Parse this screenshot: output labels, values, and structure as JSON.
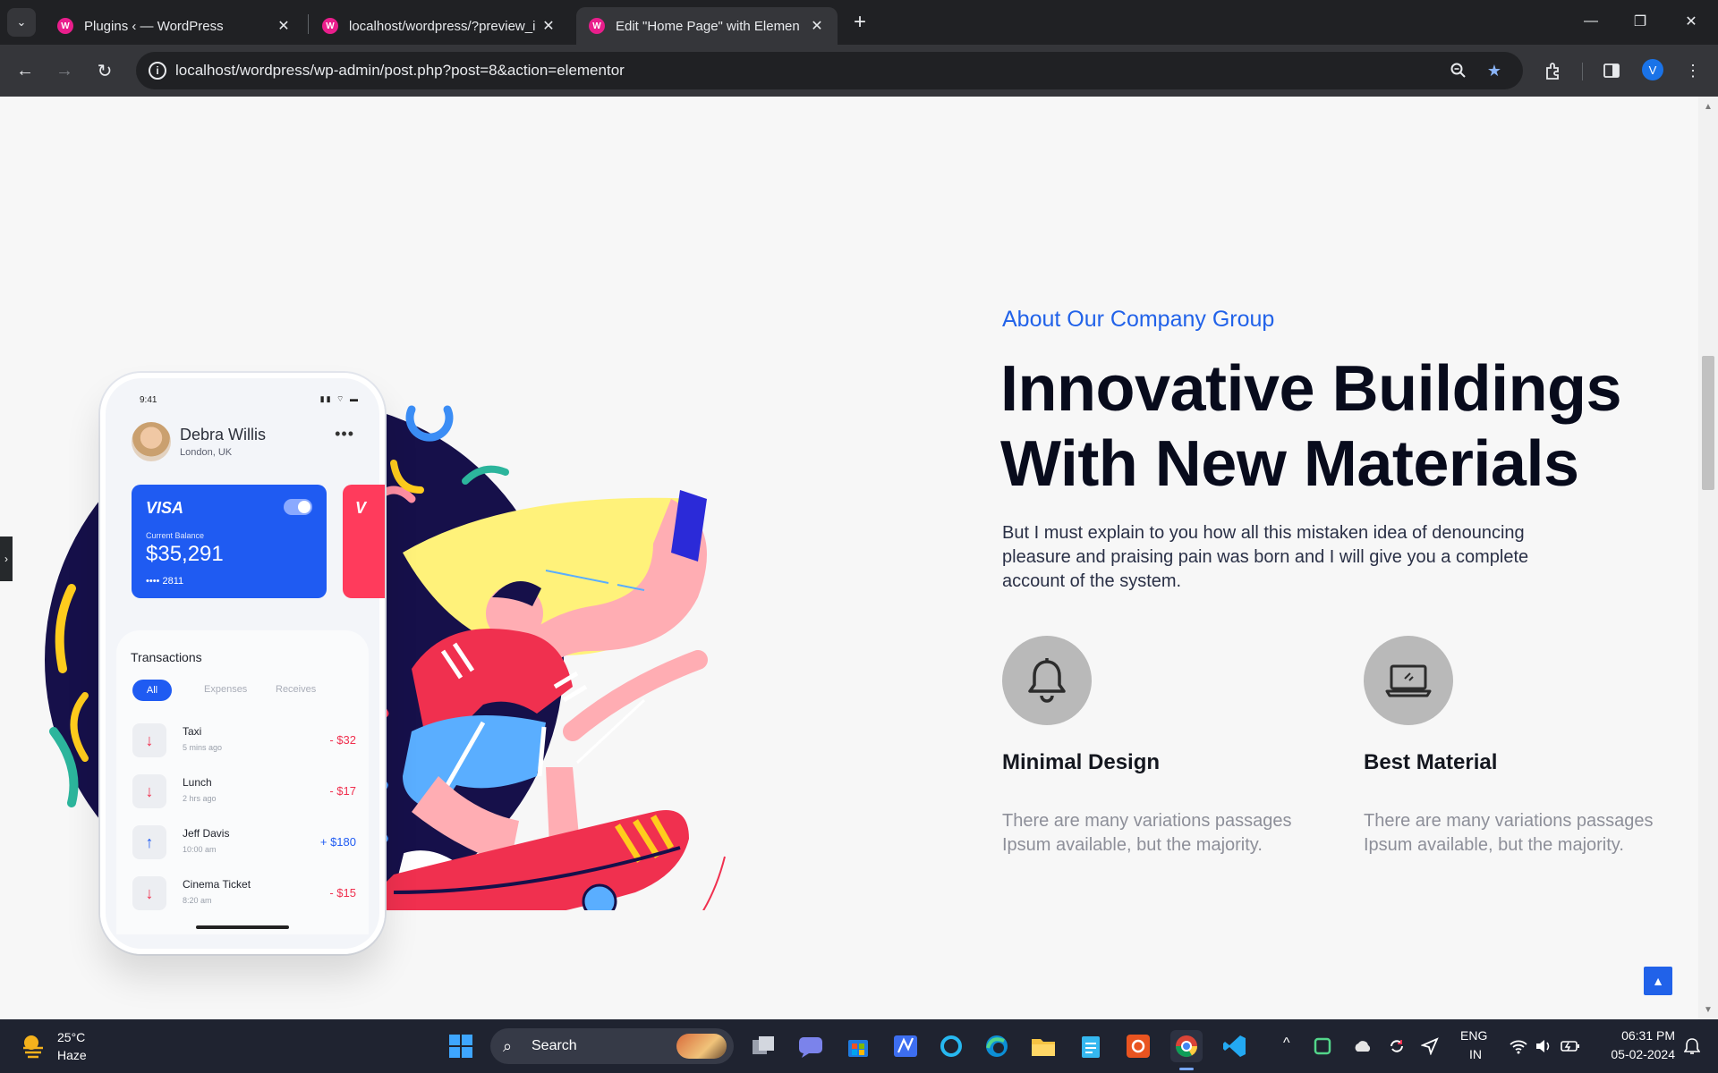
{
  "browser": {
    "tabs": [
      {
        "title": "Plugins ‹ — WordPress",
        "active": false
      },
      {
        "title": "localhost/wordpress/?preview_i",
        "active": false
      },
      {
        "title": "Edit \"Home Page\" with Element",
        "active": true
      }
    ],
    "url_host": "localhost",
    "url_path": "/wordpress/wp-admin/post.php?post=8&action=elementor",
    "profile_initial": "V"
  },
  "content": {
    "subtitle": "About Our Company Group",
    "headline": "Innovative Buildings With New Materials",
    "lead": "But I must explain to you how all this mistaken idea of denouncing pleasure and praising pain was born and I will give you a complete account of the system.",
    "features": [
      {
        "icon": "bell-icon",
        "title": "Minimal Design",
        "text": "There are many variations passages Ipsum available, but the majority."
      },
      {
        "icon": "laptop-icon",
        "title": "Best Material",
        "text": "There are many variations passages Ipsum available, but the majority."
      }
    ]
  },
  "phone": {
    "time": "9:41",
    "user_name": "Debra Willis",
    "user_location": "London, UK",
    "card_brand": "VISA",
    "balance_label": "Current Balance",
    "balance": "$35,291",
    "card_number": "•••• 2811",
    "card2_brand": "V",
    "transactions_title": "Transactions",
    "filters": [
      "All",
      "Expenses",
      "Receives"
    ],
    "transactions": [
      {
        "name": "Taxi",
        "time": "5 mins ago",
        "amount": "- $32",
        "direction": "down"
      },
      {
        "name": "Lunch",
        "time": "2 hrs ago",
        "amount": "- $17",
        "direction": "down"
      },
      {
        "name": "Jeff Davis",
        "time": "10:00 am",
        "amount": "+ $180",
        "direction": "up"
      },
      {
        "name": "Cinema Ticket",
        "time": "8:20 am",
        "amount": "- $15",
        "direction": "down"
      }
    ]
  },
  "taskbar": {
    "temperature": "25°C",
    "weather": "Haze",
    "search_label": "Search",
    "language": "ENG",
    "region": "IN",
    "time": "06:31 PM",
    "date": "05-02-2024"
  }
}
